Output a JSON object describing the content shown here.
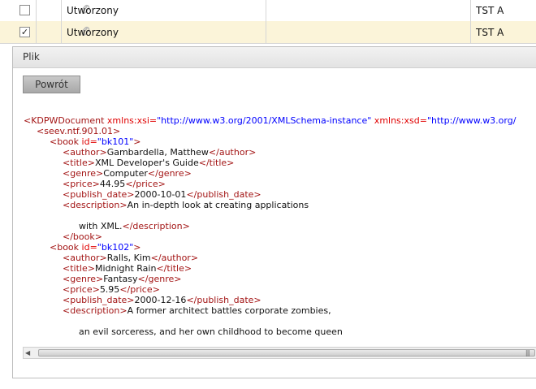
{
  "table": {
    "rows": [
      {
        "checked": false,
        "status": "Utworzony",
        "code": "TST A"
      },
      {
        "checked": true,
        "status": "Utworzony",
        "code": "TST A"
      }
    ]
  },
  "panel": {
    "title": "Plik",
    "back_label": "Powrót"
  },
  "xml_lines": {
    "l1_open": "<KDPWDocument ",
    "l1_a1": "xmlns:xsi=",
    "l1_v1": "\"http://www.w3.org/2001/XMLSchema-instance\"",
    "l1_a2": " xmlns:xsd=",
    "l1_v2": "\"http://www.w3.org/",
    "l2": "<seev.ntf.901.01>",
    "l3_open": "<book ",
    "l3_a": "id=",
    "l3_v": "\"bk101\"",
    "l3_close": ">",
    "l4_o": "<author>",
    "l4_t": "Gambardella, Matthew",
    "l4_c": "</author>",
    "l5_o": "<title>",
    "l5_t": "XML Developer's Guide",
    "l5_c": "</title>",
    "l6_o": "<genre>",
    "l6_t": "Computer",
    "l6_c": "</genre>",
    "l7_o": "<price>",
    "l7_t": "44.95",
    "l7_c": "</price>",
    "l8_o": "<publish_date>",
    "l8_t": "2000-10-01",
    "l8_c": "</publish_date>",
    "l9_o": "<description>",
    "l9_t": "An in-depth look at creating applications",
    "l10_t": "with XML.",
    "l10_c": "</description>",
    "l11": "</book>",
    "l12_open": "<book ",
    "l12_a": "id=",
    "l12_v": "\"bk102\"",
    "l12_close": ">",
    "l13_o": "<author>",
    "l13_t": "Ralls, Kim",
    "l13_c": "</author>",
    "l14_o": "<title>",
    "l14_t": "Midnight Rain",
    "l14_c": "</title>",
    "l15_o": "<genre>",
    "l15_t": "Fantasy",
    "l15_c": "</genre>",
    "l16_o": "<price>",
    "l16_t": "5.95",
    "l16_c": "</price>",
    "l17_o": "<publish_date>",
    "l17_t": "2000-12-16",
    "l17_c": "</publish_date>",
    "l18_o": "<description>",
    "l18_t": "A former architect battles corporate zombies,",
    "l19_t": "an evil sorceress, and her own childhood to become queen"
  },
  "icons": {
    "attachment": "paperclip-icon",
    "scroll_left": "scroll-left-arrow-icon",
    "grip": "scroll-grip-icon"
  },
  "colors": {
    "selected_row": "#fbf4d9",
    "xml_tag": "#a31515",
    "xml_attr": "#e00000",
    "xml_value": "#0000ff"
  }
}
